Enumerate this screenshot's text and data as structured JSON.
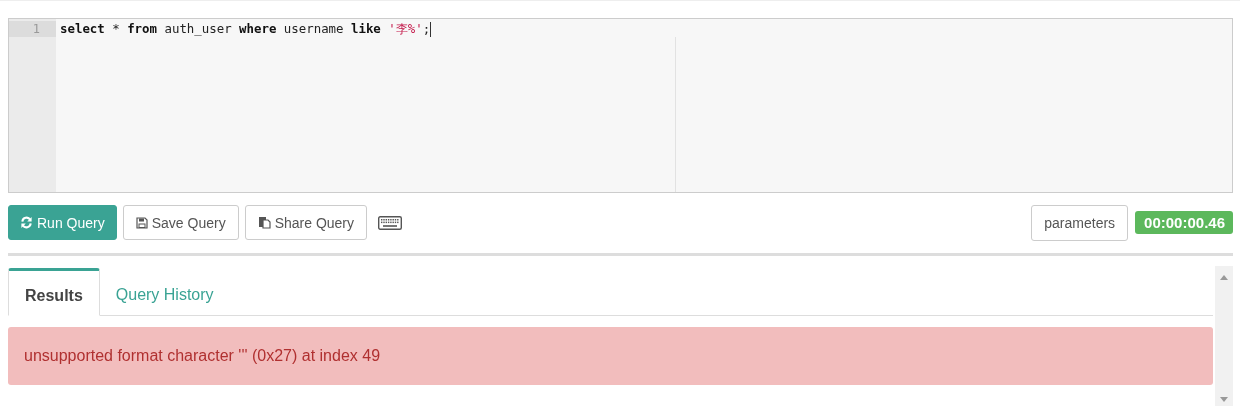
{
  "editor": {
    "lines": [
      {
        "number": "1",
        "tokens": [
          {
            "kind": "keyword",
            "text": "select"
          },
          {
            "kind": "plain",
            "text": " * "
          },
          {
            "kind": "keyword",
            "text": "from"
          },
          {
            "kind": "plain",
            "text": " auth_user "
          },
          {
            "kind": "keyword",
            "text": "where"
          },
          {
            "kind": "plain",
            "text": " username "
          },
          {
            "kind": "keyword",
            "text": "like"
          },
          {
            "kind": "string",
            "text": " '李%'"
          },
          {
            "kind": "plain",
            "text": ";"
          }
        ]
      }
    ]
  },
  "toolbar": {
    "buttons": [
      {
        "kind": "primary",
        "label": "Run Query"
      },
      {
        "kind": "default",
        "label": "Save Query"
      },
      {
        "kind": "default",
        "label": "Share Query"
      }
    ],
    "parameters_button": "parameters",
    "timer": "00:00:00.46"
  },
  "tabs": [
    {
      "label": "Results",
      "selected": true
    },
    {
      "label": "Query History",
      "selected": false
    }
  ],
  "error": "unsupported format character ''' (0x27) at index 49"
}
